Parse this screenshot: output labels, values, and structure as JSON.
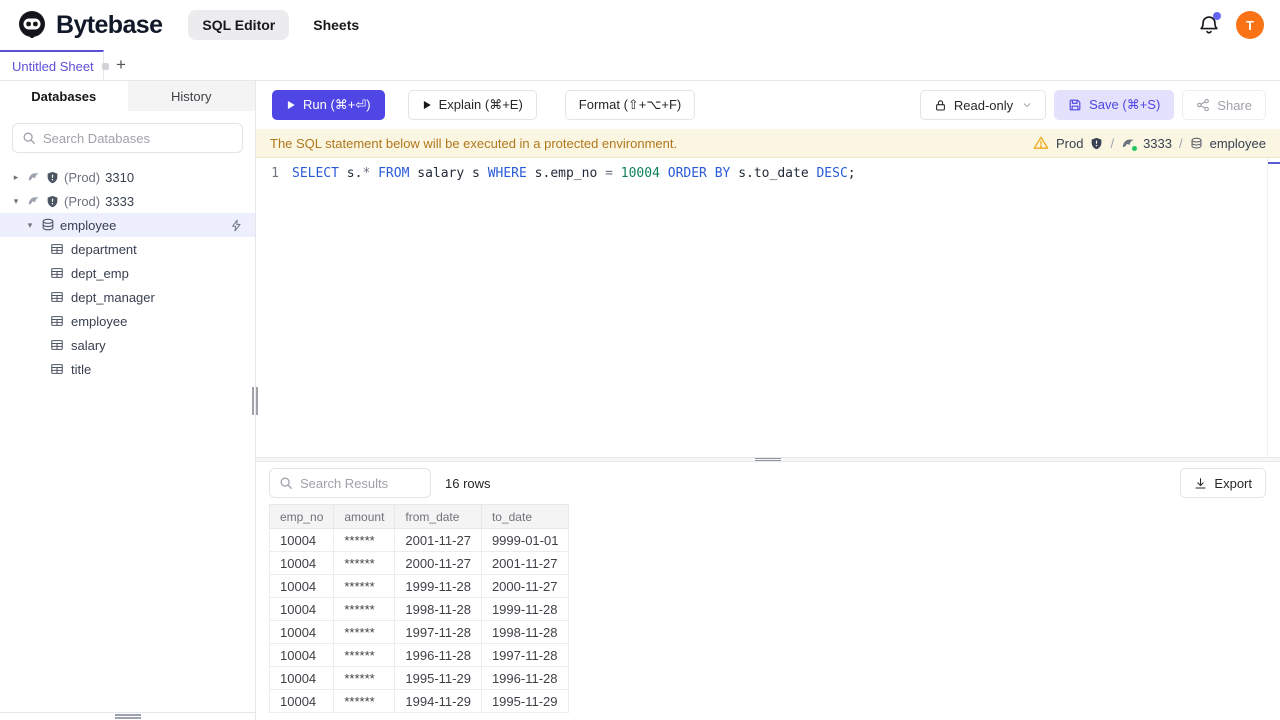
{
  "topbar": {
    "brand": "Bytebase",
    "nav": [
      {
        "label": "SQL Editor",
        "active": true
      },
      {
        "label": "Sheets",
        "active": false
      }
    ],
    "avatar_initial": "T",
    "notification_has_badge": true
  },
  "sheet_tabs": {
    "tabs": [
      {
        "label": "Untitled Sheet",
        "active": true,
        "unsaved": true
      }
    ],
    "add_label": "+"
  },
  "sidebar": {
    "tabs": [
      {
        "label": "Databases",
        "active": true
      },
      {
        "label": "History",
        "active": false
      }
    ],
    "search_placeholder": "Search Databases",
    "tree": {
      "instances": [
        {
          "env": "(Prod)",
          "name": "3310",
          "expanded": false
        },
        {
          "env": "(Prod)",
          "name": "3333",
          "expanded": true
        }
      ],
      "database": {
        "name": "employee",
        "selected": true
      },
      "tables": [
        "department",
        "dept_emp",
        "dept_manager",
        "employee",
        "salary",
        "title"
      ]
    }
  },
  "toolbar": {
    "run_label": "Run (⌘+⏎)",
    "explain_label": "Explain (⌘+E)",
    "format_label": "Format (⇧+⌥+F)",
    "readonly_label": "Read-only",
    "save_label": "Save (⌘+S)",
    "share_label": "Share"
  },
  "banner": {
    "message": "The SQL statement below will be executed in a protected environment.",
    "env_label": "Prod",
    "separator": "/",
    "instance": "3333",
    "database": "employee"
  },
  "editor": {
    "line_number": "1",
    "statement": "SELECT s.* FROM salary s WHERE s.emp_no = 10004 ORDER BY s.to_date DESC;",
    "tokens": [
      {
        "text": "SELECT",
        "type": "kw"
      },
      {
        "text": " s.",
        "type": "txt"
      },
      {
        "text": "*",
        "type": "op"
      },
      {
        "text": " ",
        "type": "txt"
      },
      {
        "text": "FROM",
        "type": "kw"
      },
      {
        "text": " salary s ",
        "type": "txt"
      },
      {
        "text": "WHERE",
        "type": "kw"
      },
      {
        "text": " s.emp_no ",
        "type": "txt"
      },
      {
        "text": "=",
        "type": "op"
      },
      {
        "text": " ",
        "type": "txt"
      },
      {
        "text": "10004",
        "type": "num"
      },
      {
        "text": " ",
        "type": "txt"
      },
      {
        "text": "ORDER BY",
        "type": "kw"
      },
      {
        "text": " s.to_date ",
        "type": "txt"
      },
      {
        "text": "DESC",
        "type": "kw"
      },
      {
        "text": ";",
        "type": "txt"
      }
    ]
  },
  "results": {
    "search_placeholder": "Search Results",
    "row_count": "16 rows",
    "export_label": "Export",
    "columns": [
      "emp_no",
      "amount",
      "from_date",
      "to_date"
    ],
    "rows": [
      [
        "10004",
        "******",
        "2001-11-27",
        "9999-01-01"
      ],
      [
        "10004",
        "******",
        "2000-11-27",
        "2001-11-27"
      ],
      [
        "10004",
        "******",
        "1999-11-28",
        "2000-11-27"
      ],
      [
        "10004",
        "******",
        "1998-11-28",
        "1999-11-28"
      ],
      [
        "10004",
        "******",
        "1997-11-28",
        "1998-11-28"
      ],
      [
        "10004",
        "******",
        "1996-11-28",
        "1997-11-28"
      ],
      [
        "10004",
        "******",
        "1995-11-29",
        "1996-11-28"
      ],
      [
        "10004",
        "******",
        "1994-11-29",
        "1995-11-29"
      ]
    ]
  },
  "icons": {
    "notification": "bell",
    "run": "play-triangle",
    "explain": "play-triangle",
    "readonly": "lock",
    "save": "floppy-disk",
    "share": "share-nodes",
    "export": "download-arrow",
    "warning": "triangle-exclamation",
    "instance": "mysql-dolphin",
    "protection": "shield",
    "database": "cylinder",
    "table": "grid",
    "query": "lightning-bolt",
    "search": "magnifier"
  },
  "colors": {
    "accent": "#4f46e5",
    "accent_light_bg": "#e3e1fb",
    "tab_accent": "#5b50d9",
    "avatar_bg": "#f97316",
    "notification_badge": "#6366f1",
    "banner_bg": "#fbf6e2",
    "banner_text": "#b0771d",
    "warning_icon": "#f0a818",
    "selected_tree_row_bg": "#edeffd",
    "status_ok": "#22c55e",
    "sql_keyword": "#2a5bd7",
    "sql_number": "#0f8157",
    "sql_operator": "#6b7280",
    "sql_text": "#1f2937"
  }
}
